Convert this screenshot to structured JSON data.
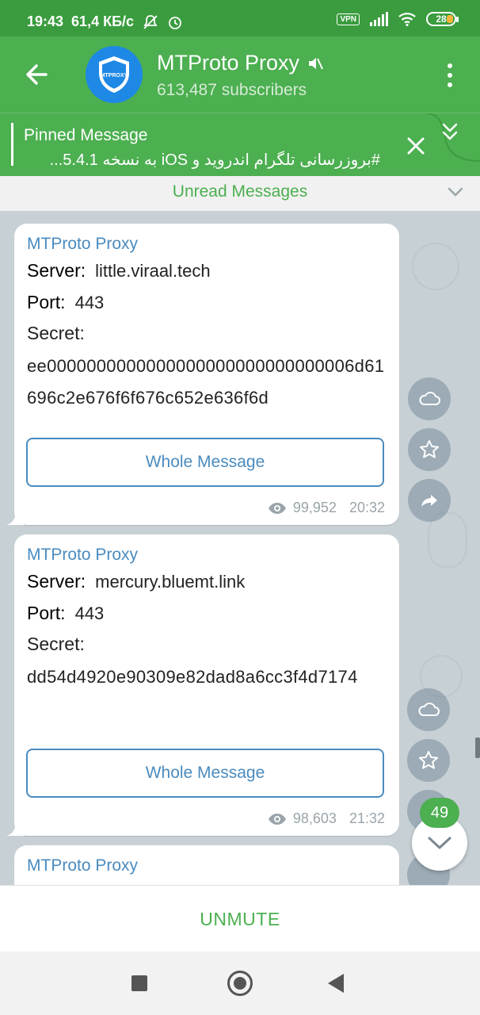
{
  "status_bar": {
    "time": "19:43",
    "net_speed": "61,4 КБ/с",
    "vpn_label": "VPN",
    "battery": "28"
  },
  "header": {
    "title": "MTProto Proxy",
    "subtitle": "613,487 subscribers",
    "avatar_text": "MTPROXY"
  },
  "pinned": {
    "title": "Pinned Message",
    "text": "#بروزرسانی تلگرام اندروید و iOS به نسخه 5.4.1..."
  },
  "unread_label": "Unread Messages",
  "messages": [
    {
      "sender": "MTProto Proxy",
      "server_label": "Server:",
      "server": "little.viraal.tech",
      "port_label": "Port:",
      "port": "443",
      "secret_label": "Secret:",
      "secret": "ee0000000000000000000000000000006d61696c2e676f6f676c652e636f6d",
      "button": "Whole Message",
      "views": "99,952",
      "time": "20:32"
    },
    {
      "sender": "MTProto Proxy",
      "server_label": "Server:",
      "server": "mercury.bluemt.link",
      "port_label": "Port:",
      "port": "443",
      "secret_label": "Secret:",
      "secret": "dd54d4920e90309e82dad8a6cc3f4d7174",
      "button": "Whole Message",
      "views": "98,603",
      "time": "21:32"
    },
    {
      "sender": "MTProto Proxy"
    }
  ],
  "unread_badge": "49",
  "bottom_action": "UNMUTE",
  "colors": {
    "status_bar": "#3a9c3e",
    "header": "#4caf50",
    "link": "#4a8bbf",
    "avatar": "#1e88e5"
  }
}
